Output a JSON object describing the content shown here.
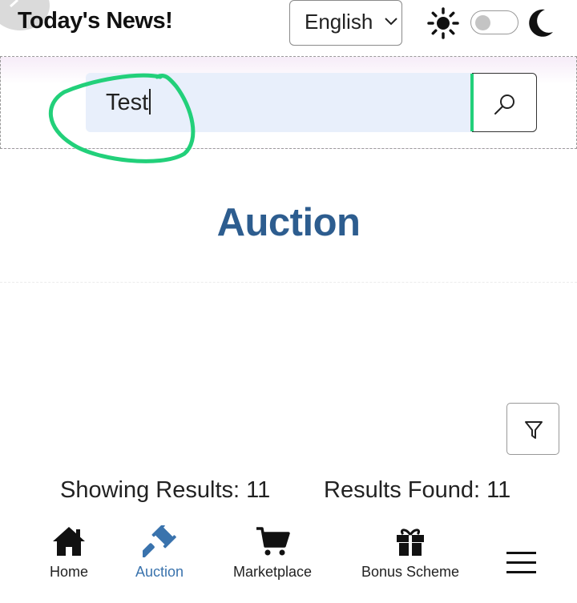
{
  "header": {
    "brand": "Today's News!",
    "language": {
      "selected": "English"
    },
    "theme": {
      "light_icon": "sun-icon",
      "dark_icon": "moon-icon",
      "dark_mode": false
    }
  },
  "search": {
    "value": "Test",
    "button_icon": "search-icon",
    "annotation_color": "#22d07a"
  },
  "page": {
    "title": "Auction"
  },
  "filter": {
    "icon": "filter-icon"
  },
  "results": {
    "showing": "Showing Results: 11",
    "found": "Results Found: 11"
  },
  "bottom_nav": {
    "items": [
      {
        "label": "Home",
        "icon": "home-icon",
        "active": false
      },
      {
        "label": "Auction",
        "icon": "gavel-icon",
        "active": true
      },
      {
        "label": "Marketplace",
        "icon": "cart-icon",
        "active": false
      },
      {
        "label": "Bonus Scheme",
        "icon": "gift-icon",
        "active": false
      }
    ],
    "menu_icon": "hamburger-icon"
  },
  "colors": {
    "accent": "#2d5d8f",
    "active_nav": "#3a73ad",
    "search_bg": "#e8effb"
  }
}
